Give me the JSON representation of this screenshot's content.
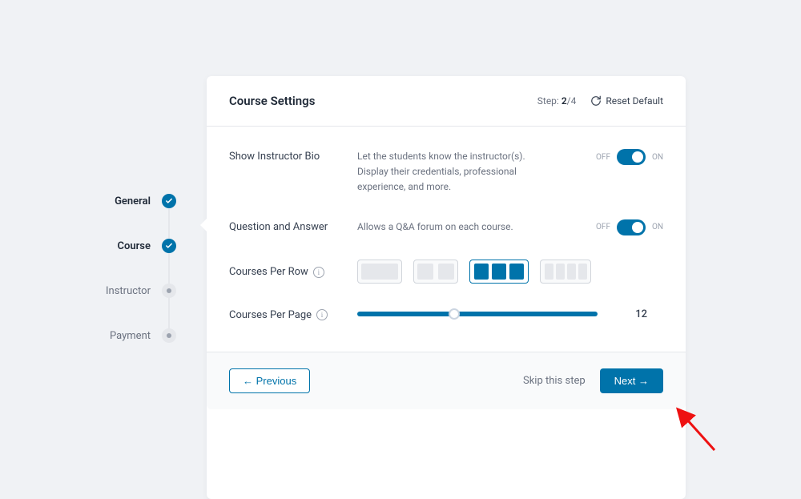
{
  "steps": {
    "items": [
      {
        "label": "General",
        "state": "completed"
      },
      {
        "label": "Course",
        "state": "completed"
      },
      {
        "label": "Instructor",
        "state": "pending"
      },
      {
        "label": "Payment",
        "state": "pending"
      }
    ]
  },
  "header": {
    "title": "Course Settings",
    "step_prefix": "Step: ",
    "step_current": "2",
    "step_sep": "/",
    "step_total": "4",
    "reset_label": "Reset Default"
  },
  "settings": {
    "bio": {
      "label": "Show Instructor Bio",
      "desc": "Let the students know the instructor(s). Display their credentials, professional experience, and more.",
      "off": "OFF",
      "on": "ON",
      "value": true
    },
    "qa": {
      "label": "Question and Answer",
      "desc": "Allows a Q&A forum on each course.",
      "off": "OFF",
      "on": "ON",
      "value": true
    },
    "per_row": {
      "label": "Courses Per Row",
      "selected": 3,
      "options": [
        1,
        2,
        3,
        4
      ]
    },
    "per_page": {
      "label": "Courses Per Page",
      "value": "12"
    }
  },
  "footer": {
    "previous": "← Previous",
    "skip": "Skip this step",
    "next": "Next →"
  }
}
